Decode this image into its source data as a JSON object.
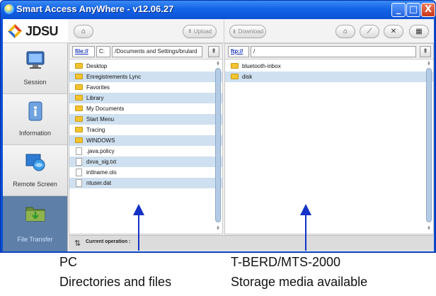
{
  "window": {
    "title": "Smart Access AnyWhere - v12.06.27",
    "minimize_label": "_",
    "maximize_label": "□",
    "close_label": "X"
  },
  "brand": {
    "logo_text": "JDSU"
  },
  "rail": {
    "items": [
      {
        "label": "Session",
        "icon": "monitor-icon",
        "active": false
      },
      {
        "label": "Information",
        "icon": "information-icon",
        "active": false
      },
      {
        "label": "Remote Screen",
        "icon": "remote-screen-icon",
        "active": false
      },
      {
        "label": "File Transfer",
        "icon": "folder-transfer-icon",
        "active": true
      }
    ]
  },
  "toolbar": {
    "left_home_icon": "home-icon",
    "upload_label": "Upload",
    "download_label": "Download",
    "right_buttons": [
      "home-icon",
      "wrench-icon",
      "x-icon",
      "network-icon"
    ]
  },
  "left_pane": {
    "protocol": "file://",
    "drive": "C:",
    "path": "/Documents and Settings/brulard",
    "go_icon": "go-up-icon",
    "rows": [
      {
        "name": "Desktop",
        "type": "folder"
      },
      {
        "name": "Enregistrements Lync",
        "type": "folder"
      },
      {
        "name": "Favorites",
        "type": "folder"
      },
      {
        "name": "Library",
        "type": "folder"
      },
      {
        "name": "My Documents",
        "type": "folder"
      },
      {
        "name": "Start Menu",
        "type": "folder"
      },
      {
        "name": "Tracing",
        "type": "folder"
      },
      {
        "name": "WINDOWS",
        "type": "folder"
      },
      {
        "name": ".java.policy",
        "type": "file"
      },
      {
        "name": "dxva_sig.txt",
        "type": "file"
      },
      {
        "name": "intlname.ols",
        "type": "file"
      },
      {
        "name": "ntuser.dat",
        "type": "file"
      }
    ]
  },
  "right_pane": {
    "protocol": "ftp://",
    "path": "/",
    "go_icon": "go-up-icon",
    "rows": [
      {
        "name": "bluetooth-inbox",
        "type": "folder"
      },
      {
        "name": "disk",
        "type": "folder"
      }
    ]
  },
  "status": {
    "label": "Current operation :"
  },
  "callouts": {
    "left_line1": "PC",
    "left_line2": "Directories and files",
    "right_line1": "T-BERD/MTS-2000",
    "right_line2": "Storage media available"
  },
  "colors": {
    "titlebar": "#1463e6",
    "row_highlight": "#cfe0f0",
    "arrow": "#1432c8",
    "active_rail": "#5e7fa8"
  }
}
